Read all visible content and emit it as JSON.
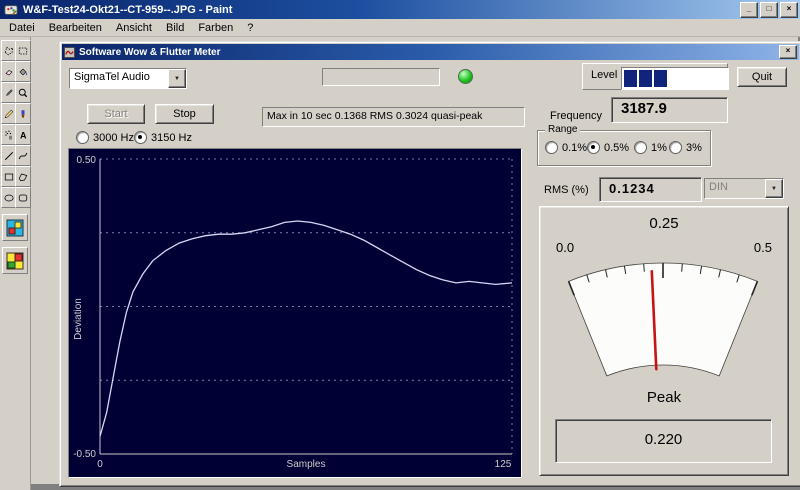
{
  "paint": {
    "title": "W&F-Test24-Okt21--CT-959--.JPG - Paint",
    "menu": [
      "Datei",
      "Bearbeiten",
      "Ansicht",
      "Bild",
      "Farben",
      "?"
    ],
    "tools": [
      "free-form-select",
      "select",
      "eraser",
      "fill",
      "color-picker",
      "magnifier",
      "pencil",
      "brush",
      "airbrush",
      "text",
      "line",
      "curve",
      "rectangle",
      "polygon",
      "ellipse",
      "rounded-rectangle"
    ]
  },
  "icons": {
    "minimize": "_",
    "maximize": "□",
    "close": "×",
    "dropdown": "▼"
  },
  "app": {
    "title": "Software Wow & Flutter Meter",
    "device_select": {
      "value": "SigmaTel Audio"
    },
    "display_field": {
      "value": ""
    },
    "level": {
      "label": "Level",
      "segments_filled": 3,
      "color": "#10247c"
    },
    "quit_button": "Quit",
    "start_button": "Start",
    "stop_button": "Stop",
    "status_text": "Max in 10 sec 0.1368 RMS 0.3024 quasi-peak",
    "frequency": {
      "label": "Frequency",
      "value": "3187.9"
    },
    "freq_radios": [
      {
        "label": "3000 Hz",
        "checked": false
      },
      {
        "label": "3150 Hz",
        "checked": true
      }
    ],
    "range": {
      "label": "Range",
      "options": [
        {
          "label": "0.1%",
          "checked": false
        },
        {
          "label": "0.5%",
          "checked": true
        },
        {
          "label": "1%",
          "checked": false
        },
        {
          "label": "3%",
          "checked": false
        }
      ]
    },
    "rms": {
      "label": "RMS (%)",
      "value": "0.1234"
    },
    "weighting_select": {
      "value": "DIN",
      "disabled": true
    },
    "meter": {
      "scale_left": "0.0",
      "scale_center": "0.25",
      "scale_right": "0.5",
      "min": 0,
      "max": 0.5,
      "value": 0.22,
      "peak_label": "Peak",
      "peak_value": "0.220",
      "needle_color": "#c41414"
    }
  },
  "chart_data": {
    "type": "line",
    "title": "",
    "xlabel": "Samples",
    "ylabel": "Deviation",
    "xlim": [
      0,
      125
    ],
    "ylim": [
      -0.5,
      0.5
    ],
    "xtick_labels": {
      "left": "0",
      "right": "125"
    },
    "ytick_labels": {
      "top": "0.50",
      "bottom": "-0.50"
    },
    "grid": "dashed horizontal at 0.25 intervals, dashed vertical at x=125",
    "line_color": "#d4d8f4",
    "background": "#000034",
    "x": [
      0,
      2,
      4,
      6,
      8,
      10,
      13,
      16,
      20,
      24,
      28,
      32,
      36,
      40,
      44,
      48,
      52,
      56,
      60,
      64,
      68,
      72,
      76,
      80,
      84,
      88,
      92,
      96,
      100,
      104,
      108,
      112,
      116,
      120,
      125
    ],
    "y": [
      -0.44,
      -0.36,
      -0.24,
      -0.12,
      -0.02,
      0.05,
      0.11,
      0.155,
      0.19,
      0.215,
      0.23,
      0.24,
      0.245,
      0.245,
      0.25,
      0.26,
      0.27,
      0.285,
      0.29,
      0.285,
      0.275,
      0.26,
      0.245,
      0.225,
      0.2,
      0.175,
      0.15,
      0.125,
      0.105,
      0.09,
      0.08,
      0.085,
      0.08,
      0.075,
      0.08
    ]
  }
}
